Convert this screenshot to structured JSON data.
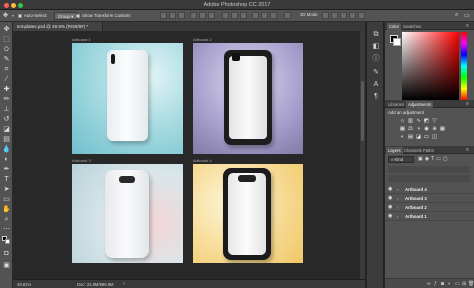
{
  "window": {
    "title": "Adobe Photoshop CC 2017"
  },
  "options": {
    "auto_select_label": "Auto-Select:",
    "auto_select_value": "Group",
    "show_transform_label": "Show Transform Controls"
  },
  "document": {
    "tab_label": "templates.psd @ 49.8% (RGB/8#) *",
    "artboards": [
      {
        "label": "Artboard 1"
      },
      {
        "label": "Artboard 2"
      },
      {
        "label": "Artboard 3"
      },
      {
        "label": "Artboard 4"
      }
    ]
  },
  "status": {
    "zoom": "49.81%",
    "doc_info": "Doc: 31.8M/888.8M"
  },
  "panels": {
    "color_tabs": [
      "Color",
      "Swatches"
    ],
    "adj_tabs": [
      "Libraries",
      "Adjustments"
    ],
    "adj_title": "Add an adjustment",
    "layer_tabs": [
      "Layers",
      "Channels",
      "Paths"
    ],
    "layer_filter": "Kind",
    "layers": [
      {
        "name": "Artboard 4"
      },
      {
        "name": "Artboard 3"
      },
      {
        "name": "Artboard 2"
      },
      {
        "name": "Artboard 1"
      }
    ]
  },
  "colors": {
    "accent": "#535353",
    "canvas": "#282828",
    "chrome_dark": "#3a3a3a"
  }
}
